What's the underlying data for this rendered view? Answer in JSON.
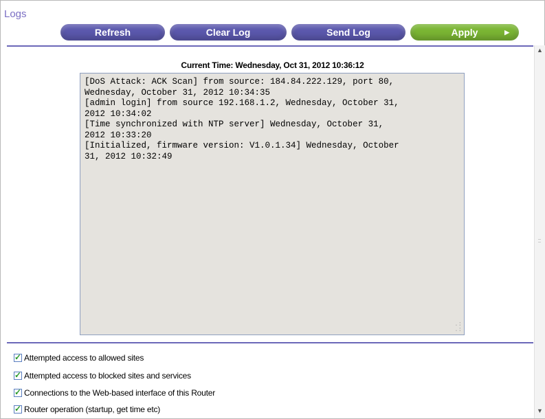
{
  "page": {
    "title": "Logs"
  },
  "toolbar": {
    "refresh_label": "Refresh",
    "clear_log_label": "Clear Log",
    "send_log_label": "Send Log",
    "apply_label": "Apply",
    "apply_icon": "arrow-right-icon"
  },
  "log": {
    "current_time": "Current Time: Wednesday, Oct 31, 2012 10:36:12",
    "content": "[DoS Attack: ACK Scan] from source: 184.84.222.129, port 80,\nWednesday, October 31, 2012 10:34:35\n[admin login] from source 192.168.1.2, Wednesday, October 31,\n2012 10:34:02\n[Time synchronized with NTP server] Wednesday, October 31,\n2012 10:33:20\n[Initialized, firmware version: V1.0.1.34] Wednesday, October\n31, 2012 10:32:49"
  },
  "options": [
    {
      "label": "Attempted access to allowed sites",
      "checked": true
    },
    {
      "label": "Attempted access to blocked sites and services",
      "checked": true
    },
    {
      "label": "Connections to the Web-based interface of this Router",
      "checked": true
    },
    {
      "label": "Router operation (startup, get time etc)",
      "checked": true
    }
  ],
  "colors": {
    "title": "#7b6fc4",
    "button_purple": "#5b58ad",
    "button_green": "#7ab533",
    "rule": "#6a67b8",
    "log_background": "#e5e3de"
  }
}
